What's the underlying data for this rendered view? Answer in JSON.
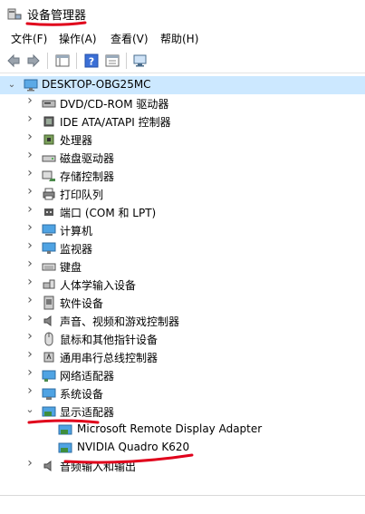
{
  "window": {
    "title": "设备管理器"
  },
  "menu": {
    "items": [
      "文件(F)",
      "操作(A)",
      "查看(V)",
      "帮助(H)"
    ]
  },
  "tree": {
    "root": "DESKTOP-OBG25MC",
    "categories": [
      {
        "label": "DVD/CD-ROM 驱动器",
        "icon": "dvd-drive-icon"
      },
      {
        "label": "IDE ATA/ATAPI 控制器",
        "icon": "ide-controller-icon"
      },
      {
        "label": "处理器",
        "icon": "processor-icon"
      },
      {
        "label": "磁盘驱动器",
        "icon": "disk-drive-icon"
      },
      {
        "label": "存储控制器",
        "icon": "storage-controller-icon"
      },
      {
        "label": "打印队列",
        "icon": "printer-icon"
      },
      {
        "label": "端口 (COM 和 LPT)",
        "icon": "port-icon"
      },
      {
        "label": "计算机",
        "icon": "computer-icon"
      },
      {
        "label": "监视器",
        "icon": "monitor-icon"
      },
      {
        "label": "键盘",
        "icon": "keyboard-icon"
      },
      {
        "label": "人体学输入设备",
        "icon": "hid-icon"
      },
      {
        "label": "软件设备",
        "icon": "software-device-icon"
      },
      {
        "label": "声音、视频和游戏控制器",
        "icon": "audio-icon"
      },
      {
        "label": "鼠标和其他指针设备",
        "icon": "mouse-icon"
      },
      {
        "label": "通用串行总线控制器",
        "icon": "usb-icon"
      },
      {
        "label": "网络适配器",
        "icon": "network-adapter-icon"
      },
      {
        "label": "系统设备",
        "icon": "system-device-icon"
      },
      {
        "label": "显示适配器",
        "icon": "display-adapter-icon",
        "expanded": true
      },
      {
        "label": "音频输入和输出",
        "icon": "audio-io-icon"
      }
    ],
    "display_children": [
      "Microsoft Remote Display Adapter",
      "NVIDIA Quadro K620"
    ]
  },
  "colors": {
    "annotation": "#e0001b",
    "selection": "#cce8ff"
  }
}
